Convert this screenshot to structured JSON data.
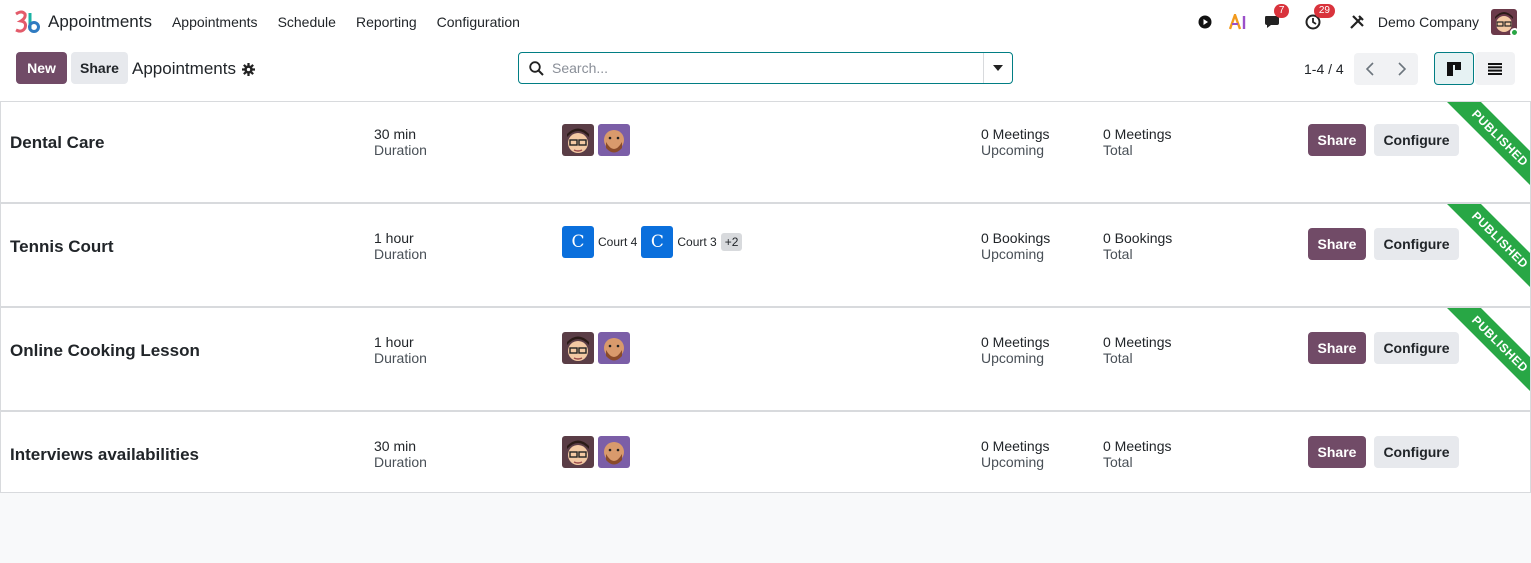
{
  "navbar": {
    "app_name": "Appointments",
    "menu": [
      "Appointments",
      "Schedule",
      "Reporting",
      "Configuration"
    ],
    "chat_count": "7",
    "activity_count": "29",
    "company": "Demo Company"
  },
  "control": {
    "new_label": "New",
    "share_label": "Share",
    "title": "Appointments",
    "search_placeholder": "Search...",
    "pager": "1-4 / 4"
  },
  "cards": [
    {
      "name": "Dental Care",
      "duration": "30 min",
      "duration_label": "Duration",
      "upcoming": "0 Meetings",
      "upcoming_label": "Upcoming",
      "total": "0 Meetings",
      "total_label": "Total",
      "published": "PUBLISHED",
      "share_label": "Share",
      "configure_label": "Configure"
    },
    {
      "name": "Tennis Court",
      "duration": "1 hour",
      "duration_label": "Duration",
      "resources": [
        {
          "initial": "C",
          "name": "Court 4"
        },
        {
          "initial": "C",
          "name": "Court 3"
        }
      ],
      "more": "+2",
      "upcoming": "0 Bookings",
      "upcoming_label": "Upcoming",
      "total": "0 Bookings",
      "total_label": "Total",
      "published": "PUBLISHED",
      "share_label": "Share",
      "configure_label": "Configure"
    },
    {
      "name": "Online Cooking Lesson",
      "duration": "1 hour",
      "duration_label": "Duration",
      "upcoming": "0 Meetings",
      "upcoming_label": "Upcoming",
      "total": "0 Meetings",
      "total_label": "Total",
      "published": "PUBLISHED",
      "share_label": "Share",
      "configure_label": "Configure"
    },
    {
      "name": "Interviews availabilities",
      "duration": "30 min",
      "duration_label": "Duration",
      "upcoming": "0 Meetings",
      "upcoming_label": "Upcoming",
      "total": "0 Meetings",
      "total_label": "Total",
      "share_label": "Share",
      "configure_label": "Configure"
    }
  ],
  "colors": {
    "primary": "#714b67",
    "secondary": "#e7e9ed",
    "published": "#28a745",
    "resource": "#0a6fdc",
    "badge": "#d9333c"
  }
}
